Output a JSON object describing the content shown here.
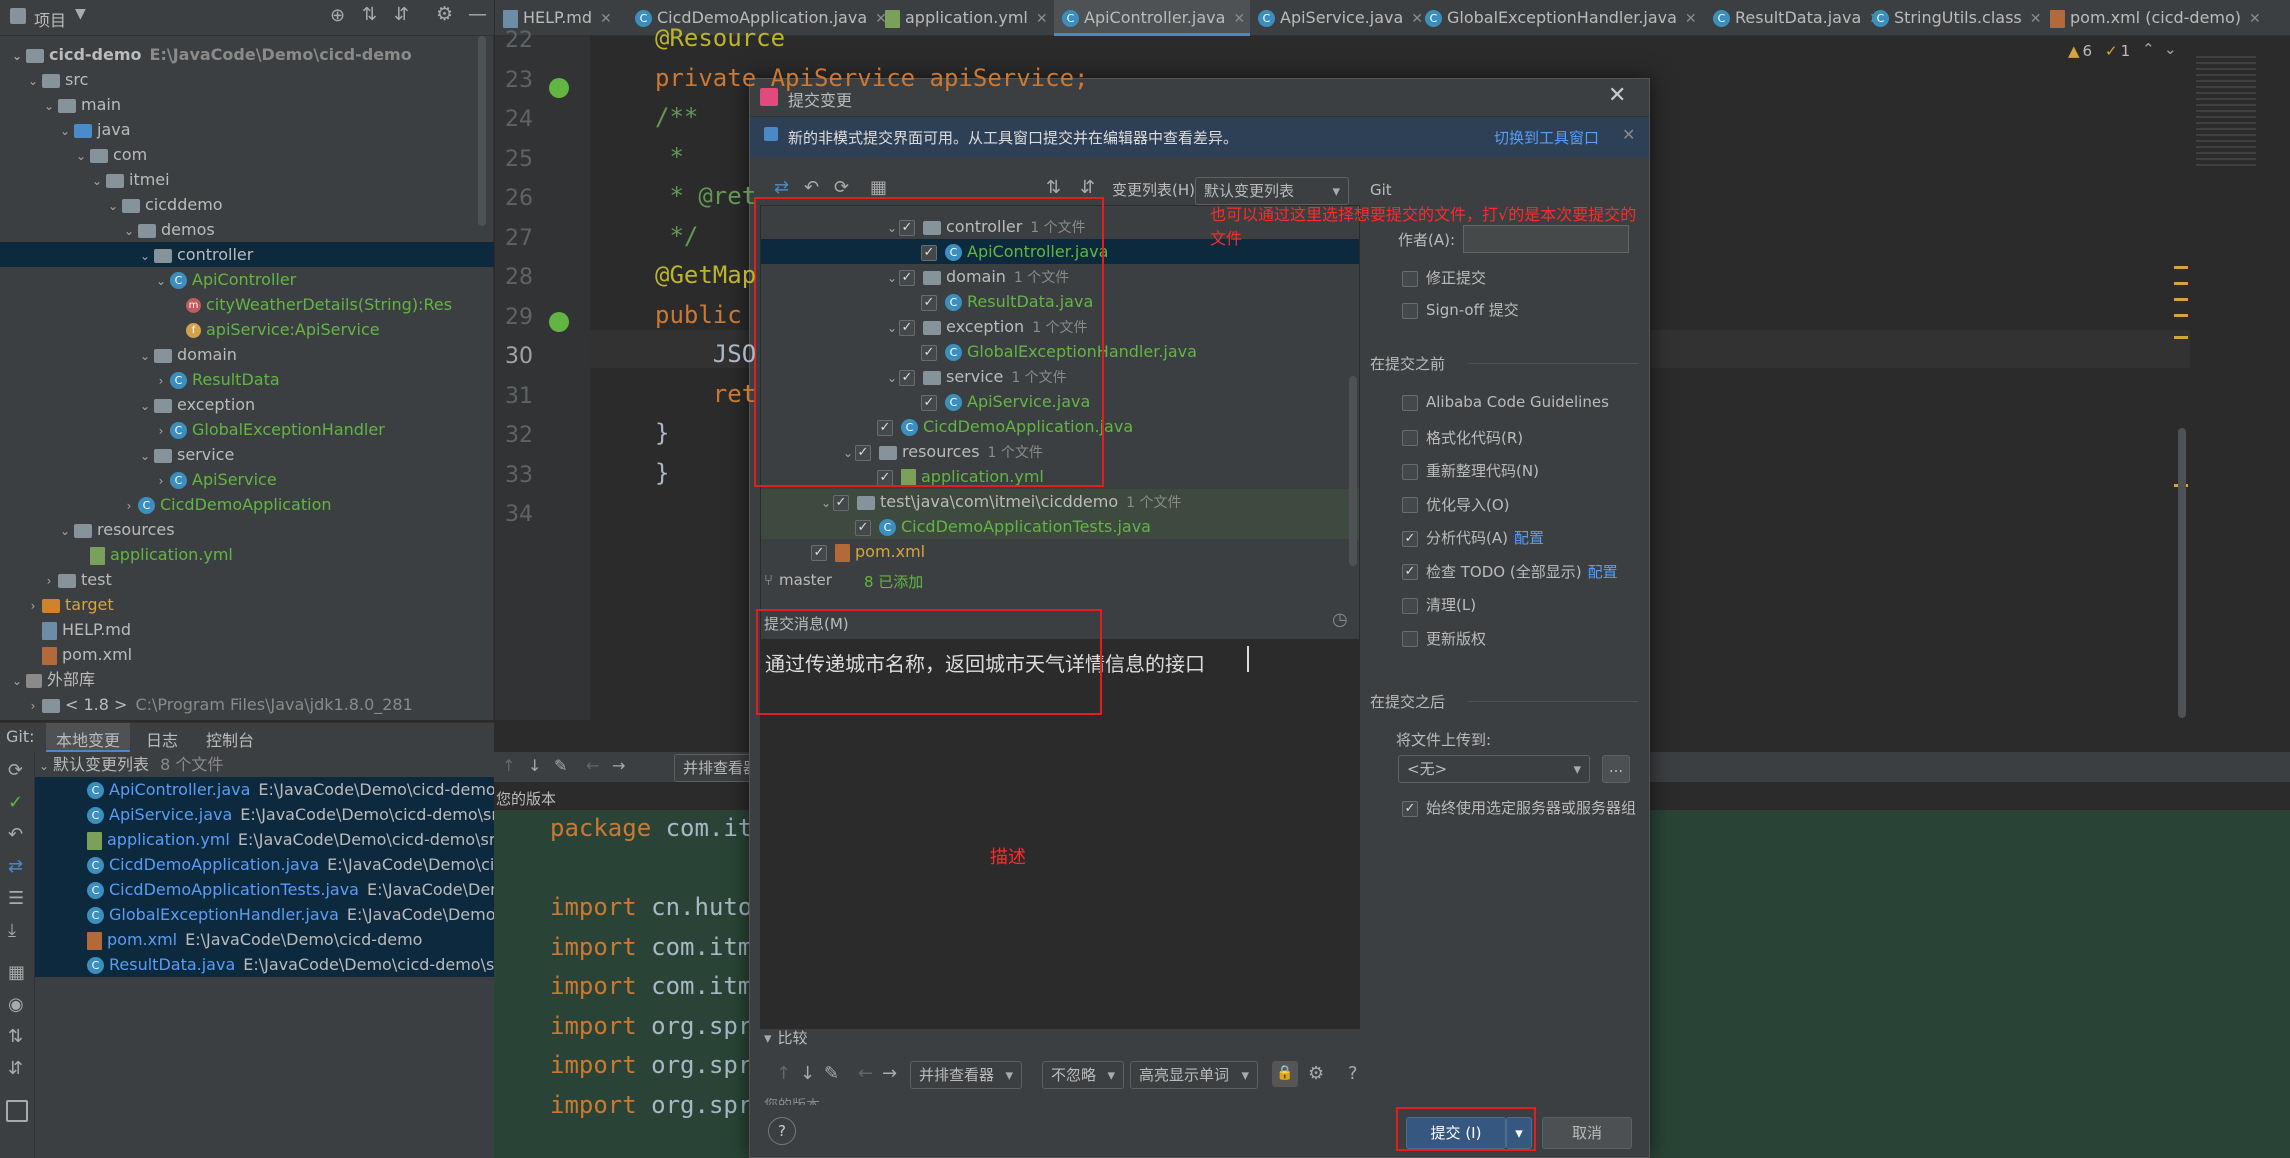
{
  "project_panel": {
    "title": "项目",
    "tree": [
      {
        "label": "cicd-demo",
        "path": "E:\\JavaCode\\Demo\\cicd-demo",
        "icon": "folder",
        "indent": 0,
        "arrow": "v",
        "style": "bold"
      },
      {
        "label": "src",
        "icon": "folder",
        "indent": 1,
        "arrow": "v"
      },
      {
        "label": "main",
        "icon": "folder",
        "indent": 2,
        "arrow": "v"
      },
      {
        "label": "java",
        "icon": "folder-blue",
        "indent": 3,
        "arrow": "v"
      },
      {
        "label": "com",
        "icon": "folder",
        "indent": 4,
        "arrow": "v"
      },
      {
        "label": "itmei",
        "icon": "folder",
        "indent": 5,
        "arrow": "v"
      },
      {
        "label": "cicddemo",
        "icon": "folder",
        "indent": 6,
        "arrow": "v"
      },
      {
        "label": "demos",
        "icon": "folder",
        "indent": 7,
        "arrow": "v"
      },
      {
        "label": "controller",
        "icon": "folder",
        "indent": 8,
        "arrow": "v",
        "style": "sel"
      },
      {
        "label": "ApiController",
        "icon": "class",
        "indent": 9,
        "arrow": "v",
        "style": "green"
      },
      {
        "label": "cityWeatherDetails(String):Res",
        "icon": "method",
        "indent": 10,
        "arrow": "",
        "style": "green"
      },
      {
        "label": "apiService:ApiService",
        "icon": "field",
        "indent": 10,
        "arrow": "",
        "style": "green"
      },
      {
        "label": "domain",
        "icon": "folder",
        "indent": 8,
        "arrow": "v"
      },
      {
        "label": "ResultData",
        "icon": "class",
        "indent": 9,
        "arrow": ">",
        "style": "green"
      },
      {
        "label": "exception",
        "icon": "folder",
        "indent": 8,
        "arrow": "v"
      },
      {
        "label": "GlobalExceptionHandler",
        "icon": "class",
        "indent": 9,
        "arrow": ">",
        "style": "green"
      },
      {
        "label": "service",
        "icon": "folder",
        "indent": 8,
        "arrow": "v"
      },
      {
        "label": "ApiService",
        "icon": "class",
        "indent": 9,
        "arrow": ">",
        "style": "green"
      },
      {
        "label": "CicdDemoApplication",
        "icon": "class",
        "indent": 7,
        "arrow": ">",
        "style": "green"
      },
      {
        "label": "resources",
        "icon": "folder",
        "indent": 3,
        "arrow": "v"
      },
      {
        "label": "application.yml",
        "icon": "yml",
        "indent": 4,
        "arrow": "",
        "style": "green"
      },
      {
        "label": "test",
        "icon": "folder",
        "indent": 2,
        "arrow": ">"
      },
      {
        "label": "target",
        "icon": "folder-orange",
        "indent": 1,
        "arrow": ">",
        "style": "yellow"
      },
      {
        "label": "HELP.md",
        "icon": "md",
        "indent": 1,
        "arrow": ""
      },
      {
        "label": "pom.xml",
        "icon": "xml",
        "indent": 1,
        "arrow": ""
      },
      {
        "label": "外部库",
        "icon": "lib",
        "indent": 0,
        "arrow": "v"
      },
      {
        "label": "< 1.8 >",
        "path": "C:\\Program Files\\Java\\jdk1.8.0_281",
        "icon": "folder",
        "indent": 1,
        "arrow": ">"
      }
    ]
  },
  "tabs": [
    {
      "label": "HELP.md",
      "icon": "md"
    },
    {
      "label": "CicdDemoApplication.java",
      "icon": "class"
    },
    {
      "label": "application.yml",
      "icon": "yml"
    },
    {
      "label": "ApiController.java",
      "icon": "class",
      "active": true
    },
    {
      "label": "ApiService.java",
      "icon": "class"
    },
    {
      "label": "GlobalExceptionHandler.java",
      "icon": "class"
    },
    {
      "label": "ResultData.java",
      "icon": "class"
    },
    {
      "label": "StringUtils.class",
      "icon": "class"
    },
    {
      "label": "pom.xml (cicd-demo)",
      "icon": "xml"
    }
  ],
  "inspections": {
    "warnings": "6",
    "weak": "1"
  },
  "editor": {
    "lines": [
      {
        "n": "22",
        "text": "@Resource",
        "color": "#bbb529"
      },
      {
        "n": "23",
        "text": "private ApiService apiService;",
        "color": "#cc7832"
      },
      {
        "n": "24",
        "text": "/**",
        "color": "#629755"
      },
      {
        "n": "25",
        "text": " *",
        "color": "#629755"
      },
      {
        "n": "26",
        "text": " * @ret",
        "color": "#629755"
      },
      {
        "n": "27",
        "text": " */",
        "color": "#629755"
      },
      {
        "n": "28",
        "text": "@GetMap",
        "color": "#bbb529"
      },
      {
        "n": "29",
        "text": "public",
        "color": "#cc7832"
      },
      {
        "n": "30",
        "text": "    JSO",
        "color": "#a9b7c6"
      },
      {
        "n": "31",
        "text": "    ret",
        "color": "#cc7832"
      },
      {
        "n": "32",
        "text": "}",
        "color": "#a9b7c6"
      },
      {
        "n": "33",
        "text": "}",
        "color": "#a9b7c6"
      },
      {
        "n": "34",
        "text": "",
        "color": "#a9b7c6"
      }
    ]
  },
  "git_toolbar": {
    "label": "Git:",
    "tabs": [
      "本地变更",
      "日志",
      "控制台"
    ]
  },
  "changes": {
    "group": "默认变更列表",
    "count": "8 个文件",
    "files": [
      {
        "name": "ApiController.java",
        "path": "E:\\JavaCode\\Demo\\cicd-demo\\sr",
        "icon": "class"
      },
      {
        "name": "ApiService.java",
        "path": "E:\\JavaCode\\Demo\\cicd-demo\\src\\r",
        "icon": "class"
      },
      {
        "name": "application.yml",
        "path": "E:\\JavaCode\\Demo\\cicd-demo\\src\\r",
        "icon": "yml"
      },
      {
        "name": "CicdDemoApplication.java",
        "path": "E:\\JavaCode\\Demo\\cicd-",
        "icon": "class"
      },
      {
        "name": "CicdDemoApplicationTests.java",
        "path": "E:\\JavaCode\\Demo\\",
        "icon": "class"
      },
      {
        "name": "GlobalExceptionHandler.java",
        "path": "E:\\JavaCode\\Demo\\cic",
        "icon": "class"
      },
      {
        "name": "pom.xml",
        "path": "E:\\JavaCode\\Demo\\cicd-demo",
        "icon": "xml"
      },
      {
        "name": "ResultData.java",
        "path": "E:\\JavaCode\\Demo\\cicd-demo\\src\\r",
        "icon": "class"
      }
    ]
  },
  "diff": {
    "viewer": "并排查看器",
    "your_version": "您的版本",
    "lines": [
      "package com.itm",
      "",
      "import cn.hutoo",
      "import com.itme",
      "import com.itme",
      "import org.spri",
      "import org.spri",
      "import org.spri"
    ]
  },
  "dialog": {
    "title": "提交变更",
    "banner": "新的非模式提交界面可用。从工具窗口提交并在编辑器中查看差异。",
    "banner_link": "切换到工具窗口",
    "changelist_label": "变更列表(H):",
    "changelist_value": "默认变更列表",
    "tree": [
      {
        "label": "controller",
        "count": "1 个文件",
        "indent": 3,
        "type": "folder",
        "arrow": "v"
      },
      {
        "label": "ApiController.java",
        "indent": 4,
        "type": "class",
        "sel": true
      },
      {
        "label": "domain",
        "count": "1 个文件",
        "indent": 3,
        "type": "folder",
        "arrow": "v"
      },
      {
        "label": "ResultData.java",
        "indent": 4,
        "type": "class"
      },
      {
        "label": "exception",
        "count": "1 个文件",
        "indent": 3,
        "type": "folder",
        "arrow": "v"
      },
      {
        "label": "GlobalExceptionHandler.java",
        "indent": 4,
        "type": "class"
      },
      {
        "label": "service",
        "count": "1 个文件",
        "indent": 3,
        "type": "folder",
        "arrow": "v"
      },
      {
        "label": "ApiService.java",
        "indent": 4,
        "type": "class"
      },
      {
        "label": "CicdDemoApplication.java",
        "indent": 2,
        "type": "class"
      },
      {
        "label": "resources",
        "count": "1 个文件",
        "indent": 1,
        "type": "folder",
        "arrow": "v"
      },
      {
        "label": "application.yml",
        "indent": 2,
        "type": "yml"
      },
      {
        "label": "test\\java\\com\\itmei\\cicddemo",
        "count": "1 个文件",
        "indent": 0,
        "type": "folder",
        "arrow": "v",
        "hl": true
      },
      {
        "label": "CicdDemoApplicationTests.java",
        "indent": 1,
        "type": "class",
        "hl": true
      },
      {
        "label": "pom.xml",
        "indent": -1,
        "type": "xml"
      }
    ],
    "branch": "master",
    "added": "8 已添加",
    "message_label": "提交消息(M)",
    "message": "通过传递城市名称，返回城市天气详情信息的接口",
    "annotation_files": "也可以通过这里选择想要提交的文件，打√的是本次要提交的文件",
    "annotation_desc": "描述",
    "git_label": "Git",
    "author_label": "作者(A):",
    "amend": "修正提交",
    "signoff": "Sign-off 提交",
    "before_label": "在提交之前",
    "before": [
      {
        "label": "Alibaba Code Guidelines",
        "checked": false
      },
      {
        "label": "格式化代码(R)",
        "checked": false
      },
      {
        "label": "重新整理代码(N)",
        "checked": false
      },
      {
        "label": "优化导入(O)",
        "checked": false
      },
      {
        "label": "分析代码(A)",
        "checked": true,
        "link": "配置"
      },
      {
        "label": "检查 TODO (全部显示)",
        "checked": true,
        "link": "配置"
      },
      {
        "label": "清理(L)",
        "checked": false
      },
      {
        "label": "更新版权",
        "checked": false
      }
    ],
    "after_label": "在提交之后",
    "upload_label": "将文件上传到:",
    "upload_value": "<无>",
    "upload_btn": "...",
    "always_use": "始终使用选定服务器或服务器组",
    "compare_label": "比较",
    "compare_viewer": "并排查看器",
    "compare_ignore": "不忽略",
    "compare_highlight": "高亮显示单词",
    "compare_your_version": "您的版本",
    "commit_btn": "提交 (I)",
    "cancel_btn": "取消",
    "help": "?"
  }
}
